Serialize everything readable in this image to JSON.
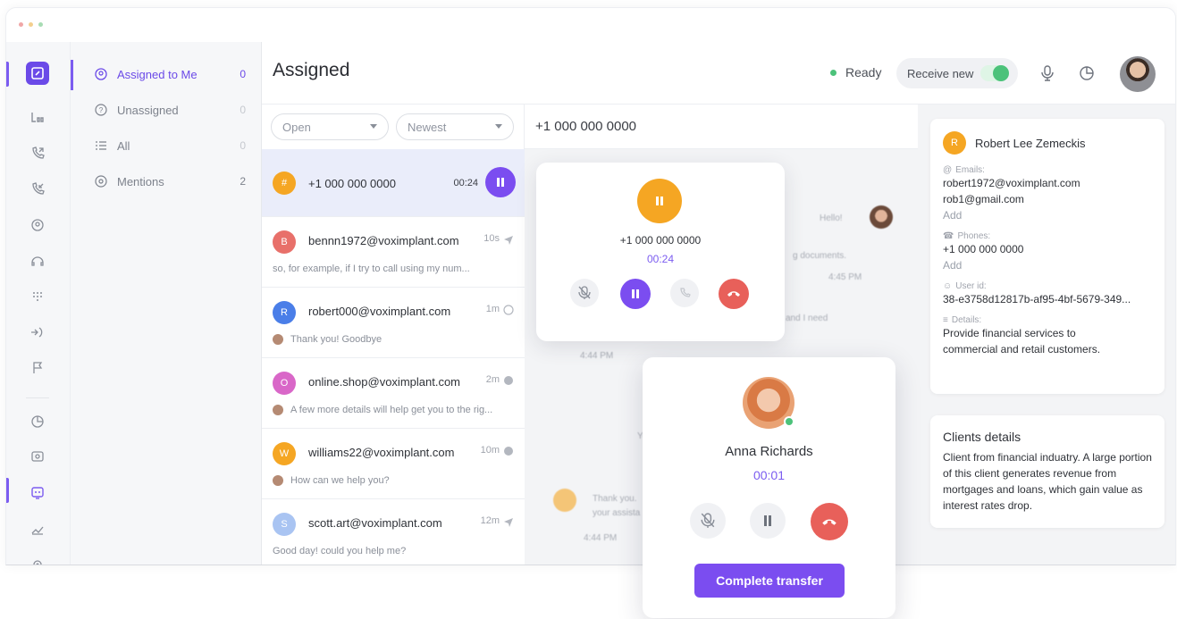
{
  "window": {
    "dot_colors": [
      "#f0a7a7",
      "#f3cf8e",
      "#a8dcb4"
    ]
  },
  "colors": {
    "accent": "#7b4df0",
    "ready": "#4cc27a",
    "hangup": "#e8605a",
    "hold": "#f5a623"
  },
  "rail": {
    "icons": [
      "logo-icon",
      "incoming-queue-icon",
      "outgoing-call-icon",
      "incoming-call-icon",
      "contacts-icon",
      "headset-icon",
      "dialpad-icon",
      "transfer-icon",
      "flag-icon",
      "chart-icon",
      "search-chat-icon",
      "chat-bot-icon",
      "analytics-icon",
      "settings-icon"
    ]
  },
  "folders": [
    {
      "label": "Assigned to Me",
      "count": "0"
    },
    {
      "label": "Unassigned",
      "count": "0"
    },
    {
      "label": "All",
      "count": "0"
    },
    {
      "label": "Mentions",
      "count": "2"
    }
  ],
  "header": {
    "title": "Assigned",
    "status": "Ready",
    "receive_label": "Receive new"
  },
  "filters": {
    "status": "Open",
    "sort": "Newest"
  },
  "conversations": [
    {
      "initial": "#",
      "name": "+1 000 000 0000",
      "time": "00:24",
      "color": "#f5a623"
    },
    {
      "initial": "B",
      "name": "bennn1972@voximplant.com",
      "time": "10s",
      "preview": "so, for example, if I try to call using my num...",
      "color": "#e8706a"
    },
    {
      "initial": "R",
      "name": "robert000@voximplant.com",
      "time": "1m",
      "preview": "Thank you! Goodbye",
      "color": "#4a7ee8"
    },
    {
      "initial": "O",
      "name": "online.shop@voximplant.com",
      "time": "2m",
      "preview": "A few more details will help get you to the rig...",
      "color": "#d967c8"
    },
    {
      "initial": "W",
      "name": "williams22@voximplant.com",
      "time": "10m",
      "preview": "How can we help you?",
      "color": "#f5a623"
    },
    {
      "initial": "S",
      "name": "scott.art@voximplant.com",
      "time": "12m",
      "preview": "Good day! could you help me?",
      "color": "#a9c4f2"
    }
  ],
  "chat": {
    "title": "+1 000 000 0000",
    "bg_fragments": [
      "Hello!",
      "g documents.",
      "4:45 PM",
      "and I need",
      "4:44 PM",
      "Yo",
      "Thank you.",
      "your assista",
      "4:44 PM"
    ]
  },
  "call": {
    "number": "+1 000 000 0000",
    "timer": "00:24"
  },
  "transfer": {
    "name": "Anna Richards",
    "timer": "00:01",
    "button": "Complete transfer"
  },
  "contact": {
    "initial": "R",
    "name": "Robert Lee Zemeckis",
    "emails_label": "Emails:",
    "emails": [
      "robert1972@voximplant.com",
      "rob1@gmail.com"
    ],
    "add_label": "Add",
    "phones_label": "Phones:",
    "phone": "+1 000 000 0000",
    "userid_label": "User id:",
    "userid": "38-e3758d12817b-af95-4bf-5679-349...",
    "details_label": "Details:",
    "details": "Provide financial services to commercial and retail customers."
  },
  "client": {
    "title": "Clients details",
    "text": "Client from financial induatry. A large portion of this client generates revenue from mortgages and loans, which gain value as interest rates drop."
  }
}
